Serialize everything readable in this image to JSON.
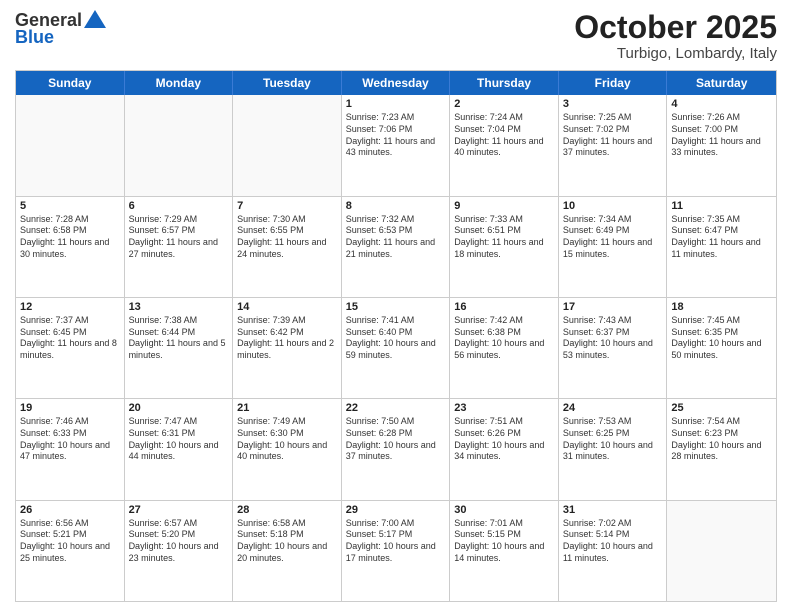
{
  "header": {
    "logo_line1": "General",
    "logo_line2": "Blue",
    "month_title": "October 2025",
    "location": "Turbigo, Lombardy, Italy"
  },
  "days_of_week": [
    "Sunday",
    "Monday",
    "Tuesday",
    "Wednesday",
    "Thursday",
    "Friday",
    "Saturday"
  ],
  "weeks": [
    [
      {
        "day": "",
        "info": ""
      },
      {
        "day": "",
        "info": ""
      },
      {
        "day": "",
        "info": ""
      },
      {
        "day": "1",
        "info": "Sunrise: 7:23 AM\nSunset: 7:06 PM\nDaylight: 11 hours and 43 minutes."
      },
      {
        "day": "2",
        "info": "Sunrise: 7:24 AM\nSunset: 7:04 PM\nDaylight: 11 hours and 40 minutes."
      },
      {
        "day": "3",
        "info": "Sunrise: 7:25 AM\nSunset: 7:02 PM\nDaylight: 11 hours and 37 minutes."
      },
      {
        "day": "4",
        "info": "Sunrise: 7:26 AM\nSunset: 7:00 PM\nDaylight: 11 hours and 33 minutes."
      }
    ],
    [
      {
        "day": "5",
        "info": "Sunrise: 7:28 AM\nSunset: 6:58 PM\nDaylight: 11 hours and 30 minutes."
      },
      {
        "day": "6",
        "info": "Sunrise: 7:29 AM\nSunset: 6:57 PM\nDaylight: 11 hours and 27 minutes."
      },
      {
        "day": "7",
        "info": "Sunrise: 7:30 AM\nSunset: 6:55 PM\nDaylight: 11 hours and 24 minutes."
      },
      {
        "day": "8",
        "info": "Sunrise: 7:32 AM\nSunset: 6:53 PM\nDaylight: 11 hours and 21 minutes."
      },
      {
        "day": "9",
        "info": "Sunrise: 7:33 AM\nSunset: 6:51 PM\nDaylight: 11 hours and 18 minutes."
      },
      {
        "day": "10",
        "info": "Sunrise: 7:34 AM\nSunset: 6:49 PM\nDaylight: 11 hours and 15 minutes."
      },
      {
        "day": "11",
        "info": "Sunrise: 7:35 AM\nSunset: 6:47 PM\nDaylight: 11 hours and 11 minutes."
      }
    ],
    [
      {
        "day": "12",
        "info": "Sunrise: 7:37 AM\nSunset: 6:45 PM\nDaylight: 11 hours and 8 minutes."
      },
      {
        "day": "13",
        "info": "Sunrise: 7:38 AM\nSunset: 6:44 PM\nDaylight: 11 hours and 5 minutes."
      },
      {
        "day": "14",
        "info": "Sunrise: 7:39 AM\nSunset: 6:42 PM\nDaylight: 11 hours and 2 minutes."
      },
      {
        "day": "15",
        "info": "Sunrise: 7:41 AM\nSunset: 6:40 PM\nDaylight: 10 hours and 59 minutes."
      },
      {
        "day": "16",
        "info": "Sunrise: 7:42 AM\nSunset: 6:38 PM\nDaylight: 10 hours and 56 minutes."
      },
      {
        "day": "17",
        "info": "Sunrise: 7:43 AM\nSunset: 6:37 PM\nDaylight: 10 hours and 53 minutes."
      },
      {
        "day": "18",
        "info": "Sunrise: 7:45 AM\nSunset: 6:35 PM\nDaylight: 10 hours and 50 minutes."
      }
    ],
    [
      {
        "day": "19",
        "info": "Sunrise: 7:46 AM\nSunset: 6:33 PM\nDaylight: 10 hours and 47 minutes."
      },
      {
        "day": "20",
        "info": "Sunrise: 7:47 AM\nSunset: 6:31 PM\nDaylight: 10 hours and 44 minutes."
      },
      {
        "day": "21",
        "info": "Sunrise: 7:49 AM\nSunset: 6:30 PM\nDaylight: 10 hours and 40 minutes."
      },
      {
        "day": "22",
        "info": "Sunrise: 7:50 AM\nSunset: 6:28 PM\nDaylight: 10 hours and 37 minutes."
      },
      {
        "day": "23",
        "info": "Sunrise: 7:51 AM\nSunset: 6:26 PM\nDaylight: 10 hours and 34 minutes."
      },
      {
        "day": "24",
        "info": "Sunrise: 7:53 AM\nSunset: 6:25 PM\nDaylight: 10 hours and 31 minutes."
      },
      {
        "day": "25",
        "info": "Sunrise: 7:54 AM\nSunset: 6:23 PM\nDaylight: 10 hours and 28 minutes."
      }
    ],
    [
      {
        "day": "26",
        "info": "Sunrise: 6:56 AM\nSunset: 5:21 PM\nDaylight: 10 hours and 25 minutes."
      },
      {
        "day": "27",
        "info": "Sunrise: 6:57 AM\nSunset: 5:20 PM\nDaylight: 10 hours and 23 minutes."
      },
      {
        "day": "28",
        "info": "Sunrise: 6:58 AM\nSunset: 5:18 PM\nDaylight: 10 hours and 20 minutes."
      },
      {
        "day": "29",
        "info": "Sunrise: 7:00 AM\nSunset: 5:17 PM\nDaylight: 10 hours and 17 minutes."
      },
      {
        "day": "30",
        "info": "Sunrise: 7:01 AM\nSunset: 5:15 PM\nDaylight: 10 hours and 14 minutes."
      },
      {
        "day": "31",
        "info": "Sunrise: 7:02 AM\nSunset: 5:14 PM\nDaylight: 10 hours and 11 minutes."
      },
      {
        "day": "",
        "info": ""
      }
    ]
  ]
}
